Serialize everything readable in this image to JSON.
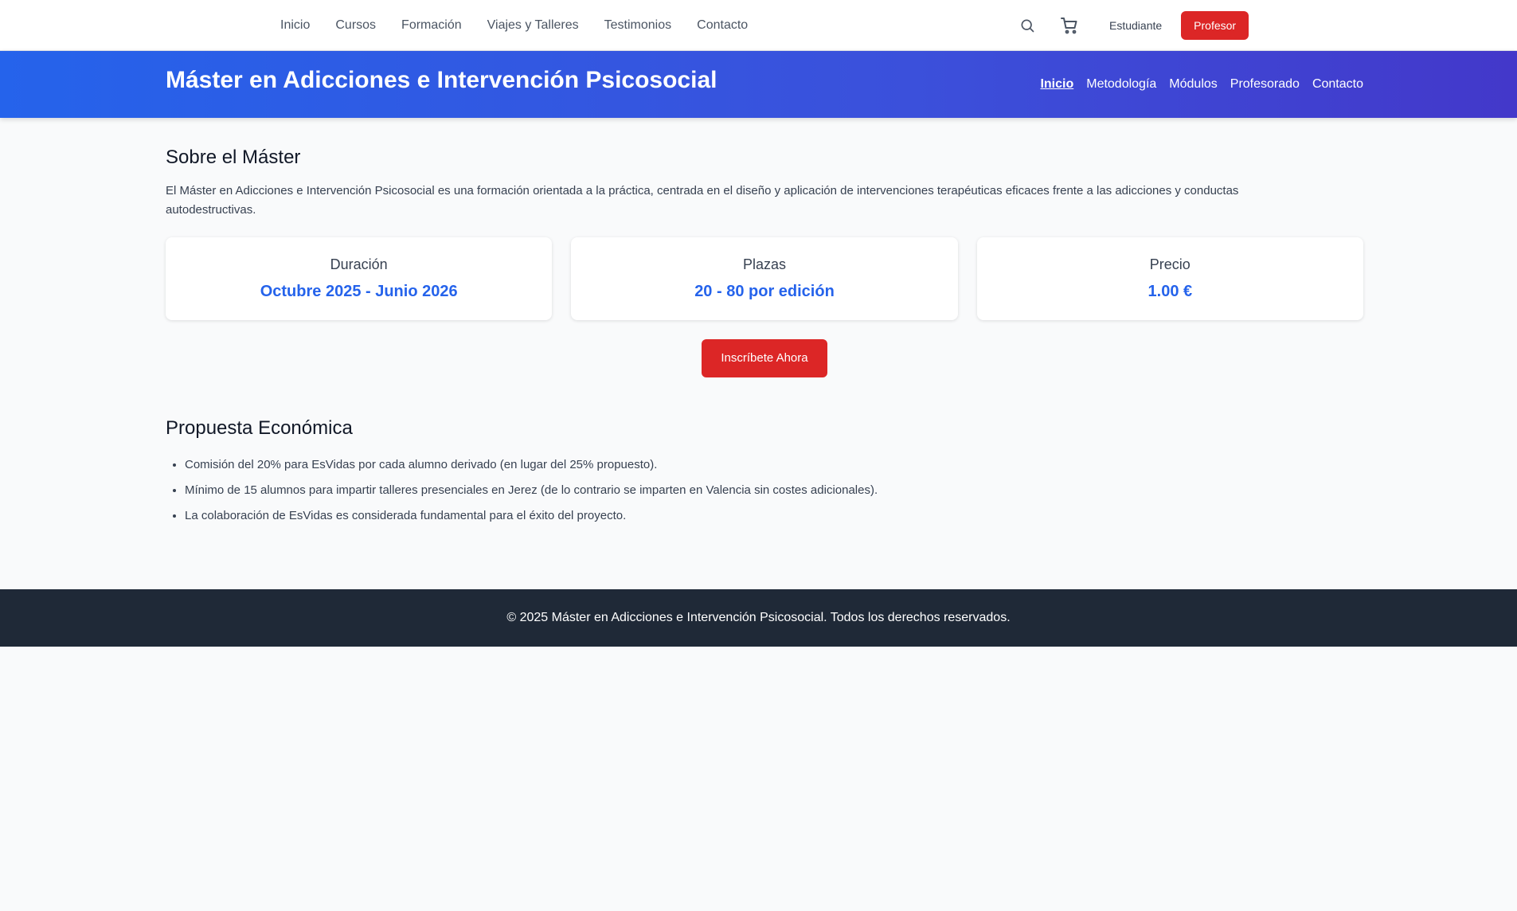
{
  "topnav": {
    "links": [
      "Inicio",
      "Cursos",
      "Formación",
      "Viajes y Talleres",
      "Testimonios",
      "Contacto"
    ],
    "search_icon": "search-icon",
    "cart_icon": "cart-icon",
    "student_label": "Estudiante",
    "teacher_label": "Profesor"
  },
  "hero": {
    "title": "Máster en Adicciones e Intervención Psicosocial",
    "links": [
      "Inicio",
      "Metodología",
      "Módulos",
      "Profesorado",
      "Contacto"
    ],
    "active_link": "Inicio"
  },
  "about": {
    "title": "Sobre el Máster",
    "text": "El Máster en Adicciones e Intervención Psicosocial es una formación orientada a la práctica, centrada en el diseño y aplicación de intervenciones terapéuticas eficaces frente a las adicciones y conductas autodestructivas.",
    "cards": [
      {
        "label": "Duración",
        "value": "Octubre 2025 - Junio 2026"
      },
      {
        "label": "Plazas",
        "value": "20 - 80 por edición"
      },
      {
        "label": "Precio",
        "value": "1.00 €"
      }
    ],
    "enroll_label": "Inscríbete Ahora"
  },
  "proposal": {
    "title": "Propuesta Económica",
    "items": [
      "Comisión del 20% para EsVidas por cada alumno derivado (en lugar del 25% propuesto).",
      "Mínimo de 15 alumnos para impartir talleres presenciales en Jerez (de lo contrario se imparten en Valencia sin costes adicionales).",
      "La colaboración de EsVidas es considerada fundamental para el éxito del proyecto."
    ]
  },
  "footer": {
    "text": "© 2025 Máster en Adicciones e Intervención Psicosocial. Todos los derechos reservados."
  },
  "colors": {
    "accent": "#2563eb",
    "brand_red": "#dc2626",
    "footer_bg": "#1f2937"
  }
}
